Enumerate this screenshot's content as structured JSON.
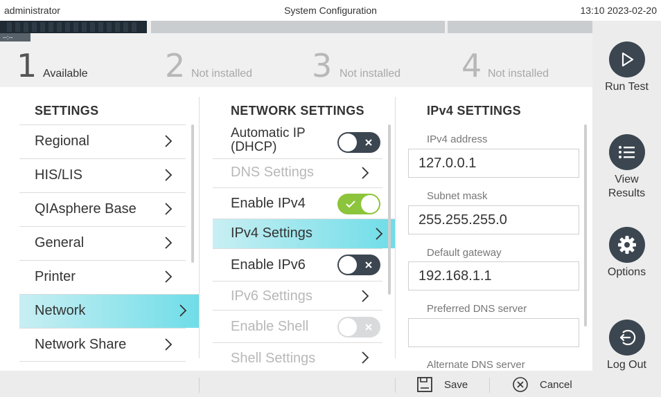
{
  "status_bar": {
    "user": "administrator",
    "title": "System Configuration",
    "datetime": "13:10 2023-02-20"
  },
  "bays": [
    {
      "number": "1",
      "status": "Available",
      "timer": "--:--"
    },
    {
      "number": "2",
      "status": "Not installed"
    },
    {
      "number": "3",
      "status": "Not installed"
    },
    {
      "number": "4",
      "status": "Not installed"
    }
  ],
  "sidebar": {
    "run_test": {
      "label": "Run Test",
      "icon": "play-icon"
    },
    "view_results": {
      "label": "View Results",
      "icon": "list-icon"
    },
    "options": {
      "label": "Options",
      "icon": "gear-icon"
    },
    "log_out": {
      "label": "Log Out",
      "icon": "logout-icon"
    }
  },
  "settings": {
    "title": "SETTINGS",
    "items": [
      "Regional",
      "HIS/LIS",
      "QIAsphere Base",
      "General",
      "Printer",
      "Network",
      "Network Share"
    ],
    "selected": "Network"
  },
  "network_settings": {
    "title": "NETWORK SETTINGS",
    "items": [
      {
        "label": "Automatic IP (DHCP)",
        "kind": "toggle",
        "state": "off"
      },
      {
        "label": "DNS Settings",
        "kind": "link",
        "state": "disabled"
      },
      {
        "label": "Enable IPv4",
        "kind": "toggle",
        "state": "on"
      },
      {
        "label": "IPv4 Settings",
        "kind": "link",
        "state": "selected"
      },
      {
        "label": "Enable IPv6",
        "kind": "toggle",
        "state": "off"
      },
      {
        "label": "IPv6 Settings",
        "kind": "link",
        "state": "disabled"
      },
      {
        "label": "Enable Shell",
        "kind": "toggle",
        "state": "disabled"
      },
      {
        "label": "Shell Settings",
        "kind": "link",
        "state": "disabled"
      }
    ]
  },
  "ipv4_settings": {
    "title": "IPv4 SETTINGS",
    "fields": [
      {
        "label": "IPv4 address",
        "value": "127.0.0.1"
      },
      {
        "label": "Subnet mask",
        "value": "255.255.255.0"
      },
      {
        "label": "Default gateway",
        "value": "192.168.1.1"
      },
      {
        "label": "Preferred DNS server",
        "value": ""
      },
      {
        "label": "Alternate DNS server",
        "value": ""
      }
    ]
  },
  "bottom_bar": {
    "save": "Save",
    "cancel": "Cancel"
  },
  "colors": {
    "accent_cyan": "#6fdde8",
    "toggle_on": "#8cc43c",
    "toggle_off": "#3b4650",
    "icon_dark": "#3b4650"
  }
}
